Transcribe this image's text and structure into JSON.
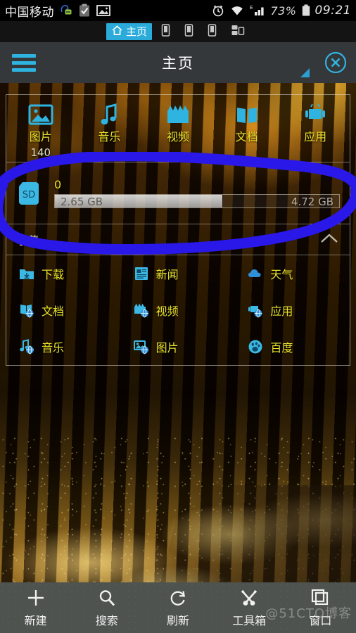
{
  "statusbar": {
    "carrier": "中国移动",
    "icons_left": [
      "chat-face-icon",
      "checklist-icon",
      "picture-icon"
    ],
    "icons_right": [
      "alarm-icon",
      "wifi-icon",
      "signal-e-icon"
    ],
    "battery_percent": "73%",
    "battery_icon": "battery-icon",
    "clock": "09:21"
  },
  "tabs": [
    {
      "label": "主页",
      "icon": "home-icon",
      "active": true
    },
    {
      "label": "",
      "icon": "device-phone-icon",
      "active": false
    },
    {
      "label": "",
      "icon": "device-phone-icon",
      "active": false
    },
    {
      "label": "",
      "icon": "device-phone-icon",
      "active": false
    },
    {
      "label": "",
      "icon": "network-lan-icon",
      "active": false
    }
  ],
  "appbar": {
    "menu_icon": "hamburger-menu-icon",
    "title": "主页",
    "resize_icon": "resize-handle-icon",
    "close_icon": "close-circle-icon",
    "accent_color": "#2fb3e0",
    "bg_color": "#35383a"
  },
  "categories": [
    {
      "label": "图片",
      "count": "140",
      "icon": "image-icon"
    },
    {
      "label": "音乐",
      "count": "",
      "icon": "music-note-icon"
    },
    {
      "label": "视频",
      "count": "",
      "icon": "video-clapper-icon"
    },
    {
      "label": "文档",
      "count": "",
      "icon": "document-book-icon"
    },
    {
      "label": "应用",
      "count": "",
      "icon": "android-app-icon"
    }
  ],
  "storage": {
    "icon": "sd-card-icon",
    "name": "0",
    "used": "2.65 GB",
    "free": "4.72 GB",
    "fill_percent": 59
  },
  "favorites": {
    "title": "收藏",
    "collapse_icon": "chevron-up-icon",
    "items": [
      {
        "label": "下载",
        "icon": "download-folder-icon"
      },
      {
        "label": "新闻",
        "icon": "news-list-icon"
      },
      {
        "label": "天气",
        "icon": "cloud-weather-icon"
      },
      {
        "label": "文档",
        "icon": "document-globe-icon"
      },
      {
        "label": "视频",
        "icon": "video-globe-icon"
      },
      {
        "label": "应用",
        "icon": "app-globe-icon"
      },
      {
        "label": "音乐",
        "icon": "music-globe-icon"
      },
      {
        "label": "图片",
        "icon": "image-globe-icon"
      },
      {
        "label": "百度",
        "icon": "baidu-paw-icon"
      }
    ],
    "label_color": "#e8e22a"
  },
  "toolbar": [
    {
      "label": "新建",
      "icon": "plus-icon"
    },
    {
      "label": "搜索",
      "icon": "search-icon"
    },
    {
      "label": "刷新",
      "icon": "refresh-icon"
    },
    {
      "label": "工具箱",
      "icon": "tools-icon"
    },
    {
      "label": "窗口",
      "icon": "windows-stack-icon"
    }
  ],
  "watermark": "@51CTO博客",
  "annotation": {
    "shape": "hand-drawn-ellipse",
    "color": "#2a18e8",
    "target": "storage-row"
  }
}
